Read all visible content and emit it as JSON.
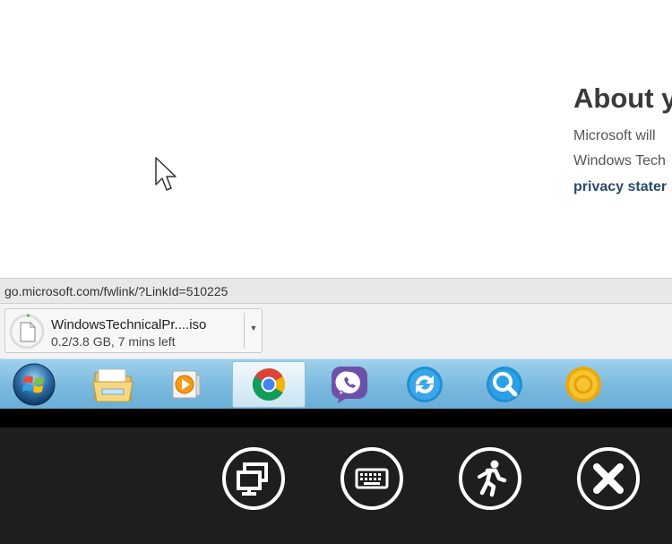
{
  "page": {
    "heading": "About y",
    "line1": "Microsoft will",
    "line2": "Windows Tech",
    "link": "privacy stater"
  },
  "status_bar": {
    "url": "go.microsoft.com/fwlink/?LinkId=510225"
  },
  "download": {
    "filename": "WindowsTechnicalPr....iso",
    "progress_text": "0.2/3.8 GB, 7 mins left",
    "menu_icon": "caret-down-icon"
  },
  "taskbar": {
    "items": [
      {
        "icon": "windows-start-icon"
      },
      {
        "icon": "file-explorer-icon"
      },
      {
        "icon": "media-player-icon"
      },
      {
        "icon": "chrome-icon",
        "active": true
      },
      {
        "icon": "viber-icon"
      },
      {
        "icon": "sync-icon"
      },
      {
        "icon": "search-app-icon"
      },
      {
        "icon": "yellow-app-icon"
      }
    ]
  },
  "remote_controls": {
    "buttons": [
      {
        "icon": "switch-monitor-icon"
      },
      {
        "icon": "keyboard-icon"
      },
      {
        "icon": "exit-run-icon"
      },
      {
        "icon": "close-icon"
      }
    ]
  },
  "colors": {
    "taskbar": "#7ab9de",
    "control_bar": "#1e1e1e",
    "link": "#2a4a6e"
  }
}
